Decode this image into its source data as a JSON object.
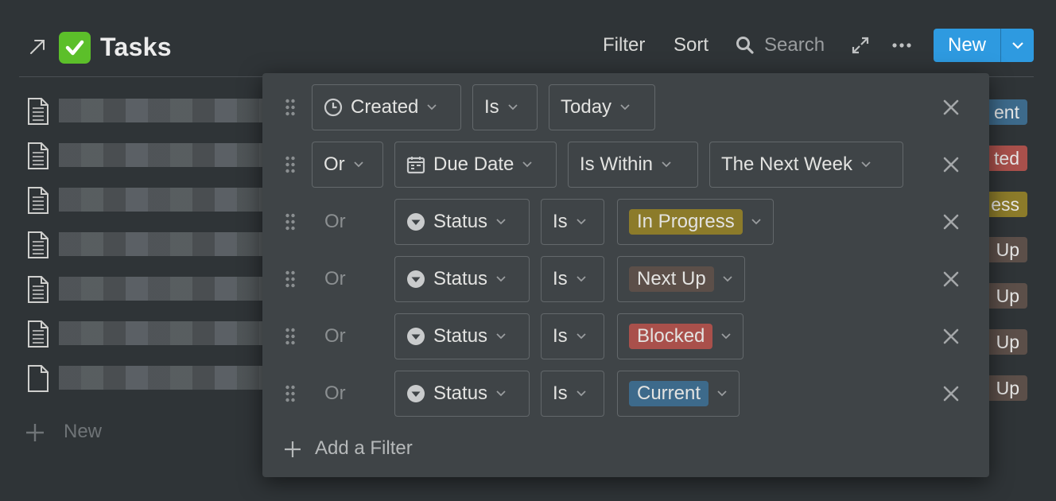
{
  "header": {
    "title": "Tasks",
    "filter_label": "Filter",
    "sort_label": "Sort",
    "search_label": "Search",
    "new_label": "New"
  },
  "list": {
    "new_label": "New",
    "peek_tags": [
      "ent",
      "ted",
      "ess",
      "Up",
      "Up",
      "Up",
      "Up"
    ]
  },
  "filters": [
    {
      "conjunction": "",
      "property": "Created",
      "property_icon": "clock-icon",
      "operator": "Is",
      "value": "Today",
      "value_is_tag": false
    },
    {
      "conjunction": "Or",
      "conjunction_dropdown": true,
      "property": "Due Date",
      "property_icon": "calendar-icon",
      "operator": "Is Within",
      "value": "The Next Week",
      "value_is_tag": false
    },
    {
      "conjunction": "Or",
      "property": "Status",
      "property_icon": "select-icon",
      "operator": "Is",
      "value": "In Progress",
      "value_is_tag": true,
      "tag_color": "#8c7b2a"
    },
    {
      "conjunction": "Or",
      "property": "Status",
      "property_icon": "select-icon",
      "operator": "Is",
      "value": "Next Up",
      "value_is_tag": true,
      "tag_color": "#5c4f49"
    },
    {
      "conjunction": "Or",
      "property": "Status",
      "property_icon": "select-icon",
      "operator": "Is",
      "value": "Blocked",
      "value_is_tag": true,
      "tag_color": "#a9504b"
    },
    {
      "conjunction": "Or",
      "property": "Status",
      "property_icon": "select-icon",
      "operator": "Is",
      "value": "Current",
      "value_is_tag": true,
      "tag_color": "#3d6a8b"
    }
  ],
  "add_filter_label": "Add a Filter",
  "colors": {
    "accent": "#2e9ae0",
    "background": "#2f3437",
    "popup": "#3f4447"
  }
}
